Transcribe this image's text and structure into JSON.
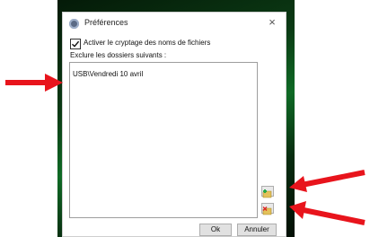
{
  "dialog": {
    "title": "Préférences",
    "close_glyph": "×",
    "encrypt_checkbox": {
      "label": "Activer le cryptage des noms de fichiers",
      "checked": true
    },
    "exclude_label": "Exclure les dossiers suivants :",
    "excluded_folders": [
      "USB\\Vendredi 10 avril"
    ],
    "add_folder_icon": "folder-add-icon",
    "remove_folder_icon": "folder-remove-icon",
    "ok_label": "Ok",
    "cancel_label": "Annuler"
  },
  "annotations": {
    "arrow_color": "#e8141c"
  },
  "colors": {
    "background": "#0b3a14",
    "dialog": "#ffffff"
  }
}
